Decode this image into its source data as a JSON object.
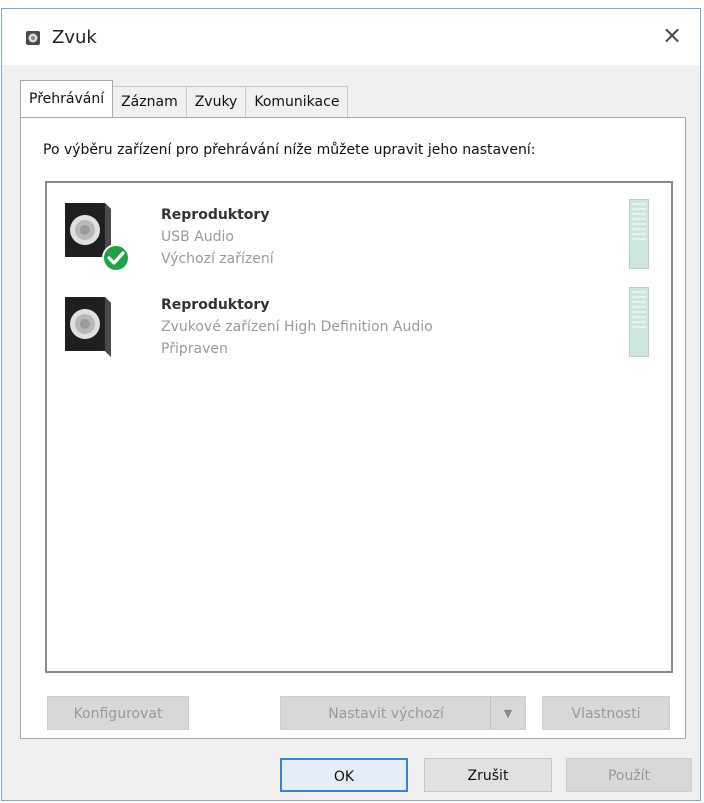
{
  "window": {
    "title": "Zvuk",
    "icons": {
      "app": "speaker-icon",
      "close": "close-icon"
    },
    "close_glyph": "×"
  },
  "tabs": [
    {
      "label": "Přehrávání",
      "active": true
    },
    {
      "label": "Záznam",
      "active": false
    },
    {
      "label": "Zvuky",
      "active": false
    },
    {
      "label": "Komunikace",
      "active": false
    }
  ],
  "panel": {
    "instruction": "Po výběru zařízení pro přehrávání níže můžete upravit jeho nastavení:"
  },
  "devices": [
    {
      "name": "Reproduktory",
      "description": "USB Audio",
      "status": "Výchozí zařízení",
      "is_default": true,
      "icon": "speaker-icon",
      "badge_icon": "checkmark-icon"
    },
    {
      "name": "Reproduktory",
      "description": "Zvukové zařízení High Definition Audio",
      "status": "Připraven",
      "is_default": false,
      "icon": "speaker-icon"
    }
  ],
  "panel_buttons": {
    "configure": "Konfigurovat",
    "set_default": "Nastavit výchozí",
    "set_default_arrow": "▼",
    "properties": "Vlastnosti"
  },
  "dialog_buttons": {
    "ok": "OK",
    "cancel": "Zrušit",
    "apply": "Použít"
  },
  "colors": {
    "accent": "#3b7fd1",
    "default_badge": "#21a147",
    "meter": "#cfe5df"
  }
}
